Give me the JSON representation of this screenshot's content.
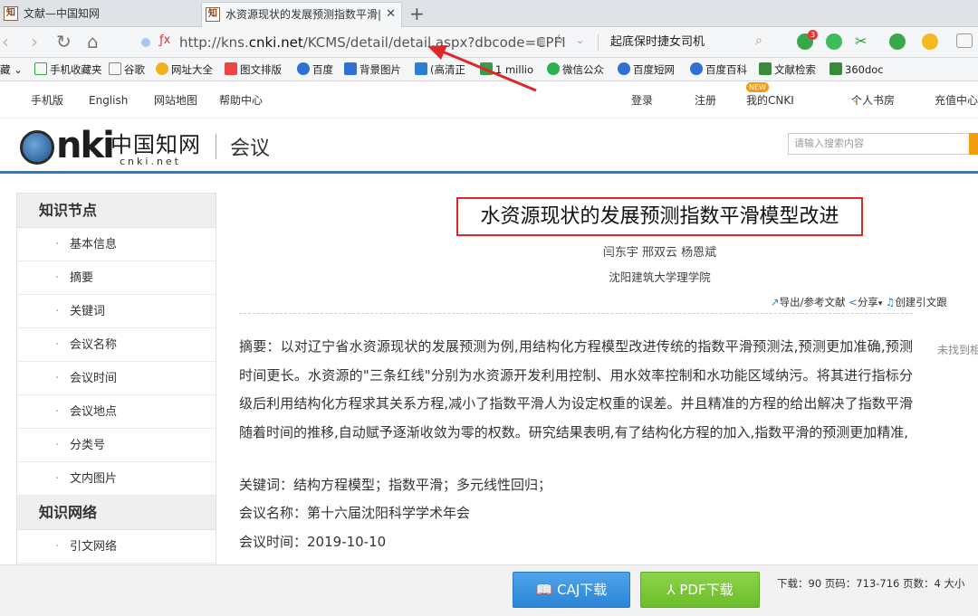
{
  "browser": {
    "tabs": [
      {
        "label": "文献—中国知网",
        "active": false
      },
      {
        "label": "水资源现状的发展预测指数平滑|",
        "active": true
      }
    ],
    "url_prefix": "http://kns.",
    "url_domain": "cnki.net",
    "url_path": "/KCMS/detail/detail.aspx?dbcode=CPFI",
    "search_text": "起底保时捷女司机",
    "ext_badge": "3"
  },
  "bookmarks": [
    {
      "label": "藏",
      "icon": ""
    },
    {
      "label": "手机收藏夹",
      "icon": "phone-icon"
    },
    {
      "label": "谷歌",
      "icon": "file-icon"
    },
    {
      "label": "网址大全",
      "icon": "globe-icon"
    },
    {
      "label": "图文排版",
      "icon": "tool-icon"
    },
    {
      "label": "百度",
      "icon": "paw-icon"
    },
    {
      "label": "背景图片",
      "icon": "k-icon"
    },
    {
      "label": "(高清正",
      "icon": "doc-icon"
    },
    {
      "label": "1 millio",
      "icon": "px-icon"
    },
    {
      "label": "微信公众",
      "icon": "wechat-icon"
    },
    {
      "label": "百度短网",
      "icon": "paw-icon"
    },
    {
      "label": "百度百科",
      "icon": "paw-icon"
    },
    {
      "label": "文献检索",
      "icon": "doc-icon"
    },
    {
      "label": "360doc",
      "icon": "doc-icon"
    }
  ],
  "site_top": {
    "mobile": "手机版",
    "english": "English",
    "sitemap": "网站地图",
    "help": "帮助中心",
    "login": "登录",
    "register": "注册",
    "mycnki": "我的CNKI",
    "new_badge": "NEW",
    "bookroom": "个人书房",
    "recharge": "充值中心"
  },
  "header": {
    "logo_cn": "中国知网",
    "logo_net": "cnki.net",
    "section": "会议",
    "search_placeholder": "请输入搜索内容"
  },
  "sidebar": {
    "knowledge_nodes": "知识节点",
    "items": [
      "基本信息",
      "摘要",
      "关键词",
      "会议名称",
      "会议时间",
      "会议地点",
      "分类号",
      "文内图片"
    ],
    "knowledge_network": "知识网络",
    "network_items": [
      "引文网络"
    ]
  },
  "article": {
    "title": "水资源现状的发展预测指数平滑模型改进",
    "authors": "闫东宇   邢双云   杨恩斌",
    "institution": "沈阳建筑大学理学院",
    "export": "导出/参考文献",
    "share": "分享",
    "cite": "创建引文跟",
    "abstract": "摘要：以对辽宁省水资源现状的发展预测为例,用结构化方程模型改进传统的指数平滑预测法,预测更加准确,预测时间更长。水资源的\"三条红线\"分别为水资源开发利用控制、用水效率控制和水功能区域纳污。将其进行指标分级后利用结构化方程求其关系方程,减小了指数平滑人为设定权重的误差。并且精准的方程的给出解决了指数平滑随着时间的推移,自动赋予逐渐收敛为零的权数。研究结果表明,有了结构化方程的加入,指数平滑的预测更加精准,",
    "keywords": "关键词：结构方程模型；指数平滑；多元线性回归；",
    "conf_name": "会议名称：第十六届沈阳科学学术年会",
    "conf_time": "会议时间：2019-10-10",
    "side_note": "未找到相"
  },
  "download": {
    "caj": "CAJ下载",
    "pdf": "PDF下载",
    "info": "下载：90   页码：713-716   页数：4   大小"
  }
}
